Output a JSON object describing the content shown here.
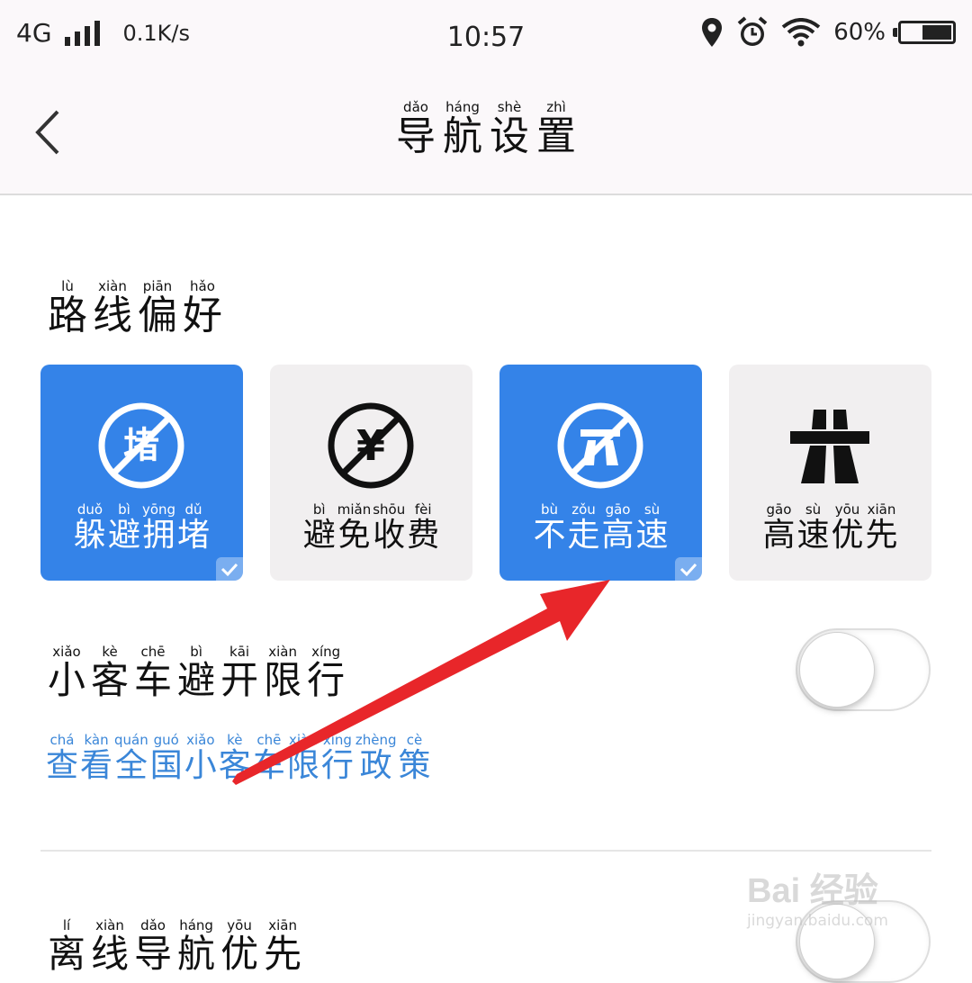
{
  "status_bar": {
    "network": "4G",
    "speed": "0.1K/s",
    "time": "10:57",
    "battery": "60%",
    "battery_level": 0.6
  },
  "header": {
    "title": [
      {
        "han": "导",
        "pin": "dǎo"
      },
      {
        "han": "航",
        "pin": "háng"
      },
      {
        "han": "设",
        "pin": "shè"
      },
      {
        "han": "置",
        "pin": "zhì"
      }
    ]
  },
  "route_preference": {
    "title": [
      {
        "han": "路",
        "pin": "lù"
      },
      {
        "han": "线",
        "pin": "xiàn"
      },
      {
        "han": "偏",
        "pin": "piān"
      },
      {
        "han": "好",
        "pin": "hǎo"
      }
    ],
    "options": [
      {
        "icon": "avoid-congestion-icon",
        "icon_glyph": "堵",
        "selected": true,
        "label": [
          {
            "han": "躲",
            "pin": "duǒ"
          },
          {
            "han": "避",
            "pin": "bì"
          },
          {
            "han": "拥",
            "pin": "yōng"
          },
          {
            "han": "堵",
            "pin": "dǔ"
          }
        ]
      },
      {
        "icon": "avoid-tolls-icon",
        "icon_glyph": "¥",
        "selected": false,
        "label": [
          {
            "han": "避",
            "pin": "bì"
          },
          {
            "han": "免",
            "pin": "miǎn"
          },
          {
            "han": "收",
            "pin": "shōu"
          },
          {
            "han": "费",
            "pin": "fèi"
          }
        ]
      },
      {
        "icon": "no-highway-icon",
        "selected": true,
        "label": [
          {
            "han": "不",
            "pin": "bù"
          },
          {
            "han": "走",
            "pin": "zǒu"
          },
          {
            "han": "高",
            "pin": "gāo"
          },
          {
            "han": "速",
            "pin": "sù"
          }
        ]
      },
      {
        "icon": "highway-icon",
        "selected": false,
        "label": [
          {
            "han": "高",
            "pin": "gāo"
          },
          {
            "han": "速",
            "pin": "sù"
          },
          {
            "han": "优",
            "pin": "yōu"
          },
          {
            "han": "先",
            "pin": "xiān"
          }
        ]
      }
    ]
  },
  "car_restriction": {
    "title": [
      {
        "han": "小",
        "pin": "xiǎo"
      },
      {
        "han": "客",
        "pin": "kè"
      },
      {
        "han": "车",
        "pin": "chē"
      },
      {
        "han": "避",
        "pin": "bì"
      },
      {
        "han": "开",
        "pin": "kāi"
      },
      {
        "han": "限",
        "pin": "xiàn"
      },
      {
        "han": "行",
        "pin": "xíng"
      }
    ],
    "enabled": false,
    "link": [
      {
        "han": "查",
        "pin": "chá"
      },
      {
        "han": "看",
        "pin": "kàn"
      },
      {
        "han": "全",
        "pin": "quán"
      },
      {
        "han": "国",
        "pin": "guó"
      },
      {
        "han": "小",
        "pin": "xiǎo"
      },
      {
        "han": "客",
        "pin": "kè"
      },
      {
        "han": "车",
        "pin": "chē"
      },
      {
        "han": "限",
        "pin": "xiàn"
      },
      {
        "han": "行",
        "pin": "xíng"
      },
      {
        "han": "政",
        "pin": "zhèng"
      },
      {
        "han": "策",
        "pin": "cè"
      }
    ]
  },
  "offline_priority": {
    "title": [
      {
        "han": "离",
        "pin": "lí"
      },
      {
        "han": "线",
        "pin": "xiàn"
      },
      {
        "han": "导",
        "pin": "dǎo"
      },
      {
        "han": "航",
        "pin": "háng"
      },
      {
        "han": "优",
        "pin": "yōu"
      },
      {
        "han": "先",
        "pin": "xiān"
      }
    ],
    "enabled": false
  },
  "watermark": {
    "brand": "Bai  经验",
    "url": "jingyan.baidu.com"
  },
  "colors": {
    "accent": "#3483e8",
    "link": "#3a86d8",
    "annotation_arrow": "#e8262a"
  }
}
